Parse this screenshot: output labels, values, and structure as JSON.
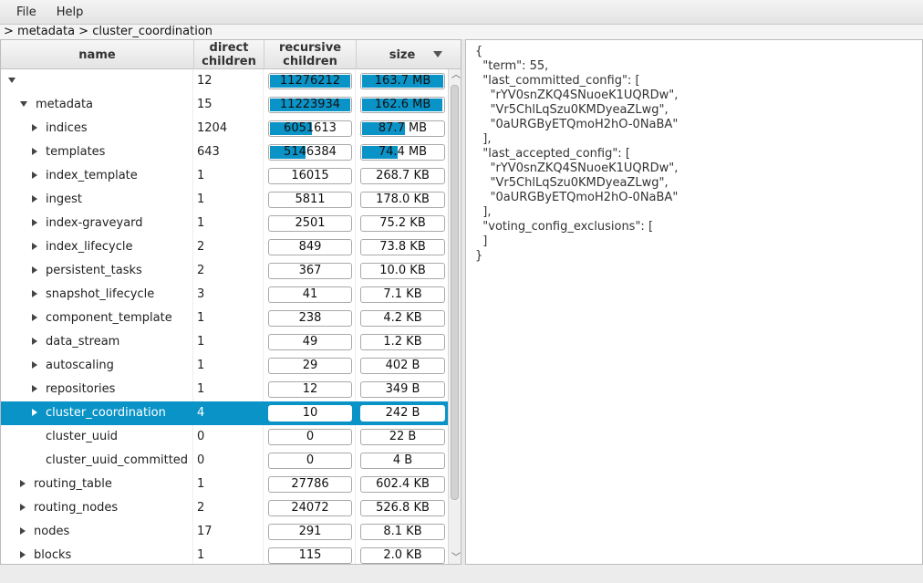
{
  "menu": [
    "File",
    "Help"
  ],
  "breadcrumb": "> metadata > cluster_coordination",
  "columns": {
    "name": "name",
    "direct": "direct\nchildren",
    "recursive": "recursive\nchildren",
    "size": "size"
  },
  "rows": [
    {
      "name": "",
      "toggle": "down",
      "indent": 0,
      "direct": "12",
      "recursive": "11276212",
      "recursive_fill": 1.0,
      "size": "163.7 MB",
      "size_fill": 1.0
    },
    {
      "name": "metadata",
      "toggle": "down",
      "indent": 1,
      "direct": "15",
      "recursive": "11223934",
      "recursive_fill": 0.995,
      "size": "162.6 MB",
      "size_fill": 0.993
    },
    {
      "name": "indices",
      "toggle": "right",
      "indent": 2,
      "direct": "1204",
      "recursive": "6051613",
      "recursive_fill": 0.537,
      "size": "87.7 MB",
      "size_fill": 0.536
    },
    {
      "name": "templates",
      "toggle": "right",
      "indent": 2,
      "direct": "643",
      "recursive": "5146384",
      "recursive_fill": 0.456,
      "size": "74.4 MB",
      "size_fill": 0.455
    },
    {
      "name": "index_template",
      "toggle": "right",
      "indent": 2,
      "direct": "1",
      "recursive": "16015",
      "recursive_fill": 0,
      "size": "268.7 KB",
      "size_fill": 0
    },
    {
      "name": "ingest",
      "toggle": "right",
      "indent": 2,
      "direct": "1",
      "recursive": "5811",
      "recursive_fill": 0,
      "size": "178.0 KB",
      "size_fill": 0
    },
    {
      "name": "index-graveyard",
      "toggle": "right",
      "indent": 2,
      "direct": "1",
      "recursive": "2501",
      "recursive_fill": 0,
      "size": "75.2 KB",
      "size_fill": 0
    },
    {
      "name": "index_lifecycle",
      "toggle": "right",
      "indent": 2,
      "direct": "2",
      "recursive": "849",
      "recursive_fill": 0,
      "size": "73.8 KB",
      "size_fill": 0
    },
    {
      "name": "persistent_tasks",
      "toggle": "right",
      "indent": 2,
      "direct": "2",
      "recursive": "367",
      "recursive_fill": 0,
      "size": "10.0 KB",
      "size_fill": 0
    },
    {
      "name": "snapshot_lifecycle",
      "toggle": "right",
      "indent": 2,
      "direct": "3",
      "recursive": "41",
      "recursive_fill": 0,
      "size": "7.1 KB",
      "size_fill": 0
    },
    {
      "name": "component_template",
      "toggle": "right",
      "indent": 2,
      "direct": "1",
      "recursive": "238",
      "recursive_fill": 0,
      "size": "4.2 KB",
      "size_fill": 0
    },
    {
      "name": "data_stream",
      "toggle": "right",
      "indent": 2,
      "direct": "1",
      "recursive": "49",
      "recursive_fill": 0,
      "size": "1.2 KB",
      "size_fill": 0
    },
    {
      "name": "autoscaling",
      "toggle": "right",
      "indent": 2,
      "direct": "1",
      "recursive": "29",
      "recursive_fill": 0,
      "size": "402 B",
      "size_fill": 0
    },
    {
      "name": "repositories",
      "toggle": "right",
      "indent": 2,
      "direct": "1",
      "recursive": "12",
      "recursive_fill": 0,
      "size": "349 B",
      "size_fill": 0
    },
    {
      "name": "cluster_coordination",
      "toggle": "right",
      "indent": 2,
      "direct": "4",
      "recursive": "10",
      "recursive_fill": 0,
      "size": "242 B",
      "size_fill": 0,
      "selected": true
    },
    {
      "name": "cluster_uuid",
      "toggle": "none",
      "indent": 2,
      "direct": "0",
      "recursive": "0",
      "recursive_fill": 0,
      "size": "22 B",
      "size_fill": 0
    },
    {
      "name": "cluster_uuid_committed",
      "toggle": "none",
      "indent": 2,
      "direct": "0",
      "recursive": "0",
      "recursive_fill": 0,
      "size": "4 B",
      "size_fill": 0
    },
    {
      "name": "routing_table",
      "toggle": "right",
      "indent": 1,
      "direct": "1",
      "recursive": "27786",
      "recursive_fill": 0,
      "size": "602.4 KB",
      "size_fill": 0
    },
    {
      "name": "routing_nodes",
      "toggle": "right",
      "indent": 1,
      "direct": "2",
      "recursive": "24072",
      "recursive_fill": 0,
      "size": "526.8 KB",
      "size_fill": 0
    },
    {
      "name": "nodes",
      "toggle": "right",
      "indent": 1,
      "direct": "17",
      "recursive": "291",
      "recursive_fill": 0,
      "size": "8.1 KB",
      "size_fill": 0
    },
    {
      "name": "blocks",
      "toggle": "right",
      "indent": 1,
      "direct": "1",
      "recursive": "115",
      "recursive_fill": 0,
      "size": "2.0 KB",
      "size_fill": 0
    }
  ],
  "json_lines": [
    "{",
    "  \"term\": 55,",
    "  \"last_committed_config\": [",
    "    \"rYV0snZKQ4SNuoeK1UQRDw\",",
    "    \"Vr5ChlLqSzu0KMDyeaZLwg\",",
    "    \"0aURGByETQmoH2hO-0NaBA\"",
    "  ],",
    "  \"last_accepted_config\": [",
    "    \"rYV0snZKQ4SNuoeK1UQRDw\",",
    "    \"Vr5ChlLqSzu0KMDyeaZLwg\",",
    "    \"0aURGByETQmoH2hO-0NaBA\"",
    "  ],",
    "  \"voting_config_exclusions\": [",
    "  ]",
    "}"
  ],
  "colors": {
    "accent": "#0a93c7",
    "selected_bg": "#0a93c7"
  }
}
